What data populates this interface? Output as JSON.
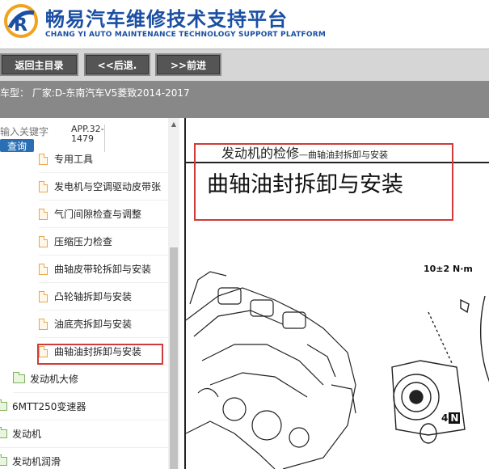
{
  "header": {
    "title": "畅易汽车维修技术支持平台",
    "subtitle": "CHANG YI AUTO MAINTENANCE TECHNOLOGY SUPPORT PLATFORM"
  },
  "toolbar": {
    "home_label": "返回主目录",
    "back_label": "<<后退.",
    "forward_label": ">>前进"
  },
  "vehicle": {
    "text": "车型： 厂家:D-东南汽车V5菱致2014-2017"
  },
  "sidebar": {
    "search_placeholder": "输入关键字",
    "search_button": "查询",
    "app_code": "APP.32-1479",
    "items": [
      {
        "label": "专用工具",
        "type": "doc"
      },
      {
        "label": "发电机与空调驱动皮带张",
        "type": "doc"
      },
      {
        "label": "气门间隙检查与调整",
        "type": "doc"
      },
      {
        "label": "压缩压力检查",
        "type": "doc"
      },
      {
        "label": "曲轴皮带轮拆卸与安装",
        "type": "doc"
      },
      {
        "label": "凸轮轴拆卸与安装",
        "type": "doc"
      },
      {
        "label": "油底壳拆卸与安装",
        "type": "doc"
      },
      {
        "label": "曲轴油封拆卸与安装",
        "type": "doc",
        "selected": true
      },
      {
        "label": "发动机大修",
        "type": "folder"
      },
      {
        "label": "6MTT250变速器",
        "type": "folder"
      },
      {
        "label": "发动机",
        "type": "folder"
      },
      {
        "label": "发动机润滑",
        "type": "folder"
      }
    ]
  },
  "document": {
    "section_title": "发动机的检修",
    "section_sub": "—曲轴油封拆卸与安装",
    "title": "曲轴油封拆卸与安装",
    "torque_label": "10±2 N·m",
    "part_number": "4",
    "part_suffix": "N"
  },
  "colors": {
    "brand": "#1a4fa3",
    "toolbar_button": "#555555",
    "vehicle_bar": "#888888",
    "highlight_red": "#d23a3a",
    "search_button": "#2a6fb3"
  }
}
